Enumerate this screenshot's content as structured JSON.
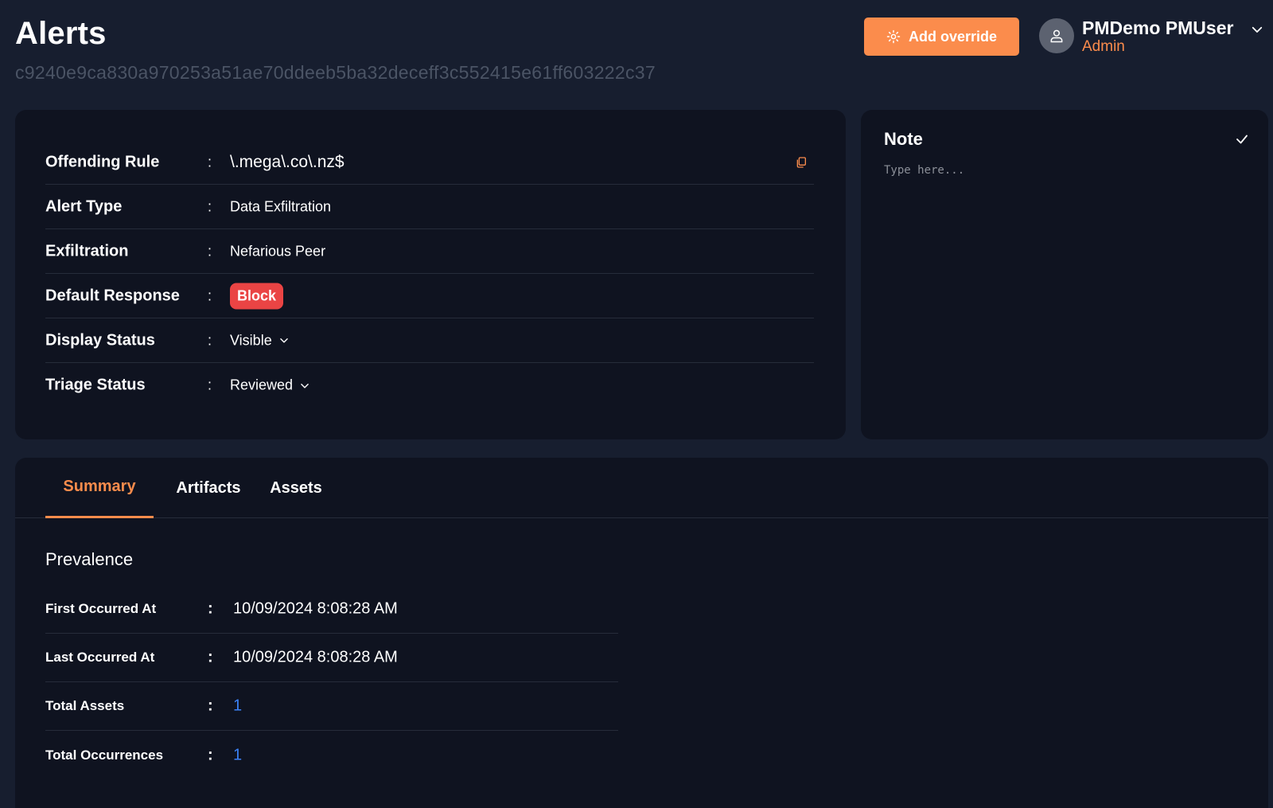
{
  "header": {
    "title": "Alerts",
    "hash": "c9240e9ca830a970253a51ae70ddeeb5ba32deceff3c552415e61ff603222c37",
    "add_override_label": "Add override"
  },
  "user": {
    "name": "PMDemo PMUser",
    "role": "Admin"
  },
  "details": {
    "rows": [
      {
        "label": "Offending Rule",
        "colon": ":",
        "value": "\\.mega\\.co\\.nz$"
      },
      {
        "label": "Alert Type",
        "colon": ":",
        "value": "Data Exfiltration"
      },
      {
        "label": "Exfiltration",
        "colon": ":",
        "value": "Nefarious Peer"
      },
      {
        "label": "Default Response",
        "colon": ":",
        "value": "Block"
      },
      {
        "label": "Display Status",
        "colon": ":",
        "value": "Visible"
      },
      {
        "label": "Triage Status",
        "colon": ":",
        "value": "Reviewed"
      }
    ]
  },
  "note": {
    "title": "Note",
    "placeholder": "Type here..."
  },
  "tabs": [
    {
      "label": "Summary",
      "active": true
    },
    {
      "label": "Artifacts",
      "active": false
    },
    {
      "label": "Assets",
      "active": false
    }
  ],
  "prevalence": {
    "title": "Prevalence",
    "rows": [
      {
        "label": "First Occurred At",
        "colon": ":",
        "value": "10/09/2024 8:08:28 AM"
      },
      {
        "label": "Last Occurred At",
        "colon": ":",
        "value": "10/09/2024 8:08:28 AM"
      },
      {
        "label": "Total Assets",
        "colon": ":",
        "value": "1"
      },
      {
        "label": "Total Occurrences",
        "colon": ":",
        "value": "1"
      }
    ]
  },
  "colors": {
    "accent": "#fb8c4c",
    "block_badge": "#ea4444",
    "link": "#3b82f6",
    "background": "#171e2f",
    "card": "#0f1320"
  },
  "icons": {
    "add_override": "gear-sun-icon",
    "avatar": "user-icon",
    "user_menu": "chevron-down-icon",
    "copy": "copy-icon",
    "note_save": "check-icon",
    "dropdown": "chevron-down-icon"
  }
}
